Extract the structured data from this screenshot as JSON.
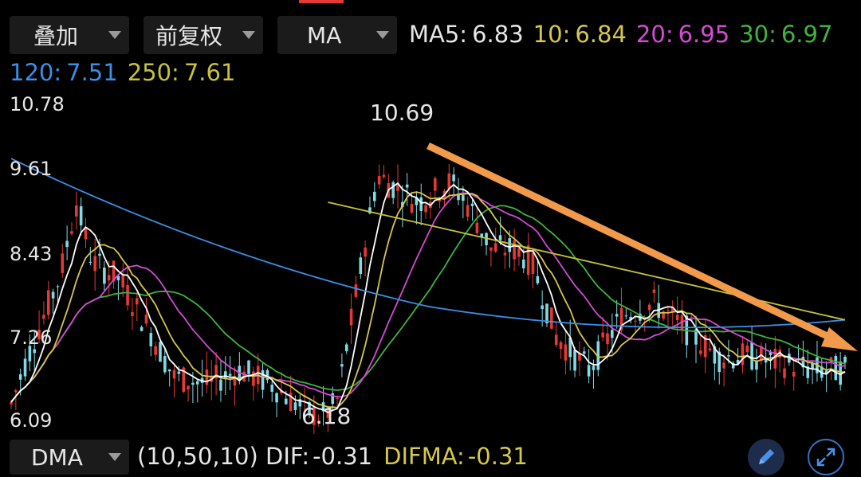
{
  "toolbar": {
    "overlay": "叠加",
    "adjust": "前复权",
    "indicator": "MA"
  },
  "ma": {
    "ma5_label": "MA5:",
    "ma5": "6.83",
    "ma10_label": "10:",
    "ma10": "6.84",
    "ma20_label": "20:",
    "ma20": "6.95",
    "ma30_label": "30:",
    "ma30": "6.97",
    "ma120_label": "120:",
    "ma120": "7.51",
    "ma250_label": "250:",
    "ma250": "7.61"
  },
  "colors": {
    "up": "#e53935",
    "down": "#7fdbe6",
    "ma5": "#ffffff",
    "ma10": "#d6c84a",
    "ma20": "#d54bd5",
    "ma30": "#3fb43f",
    "ma120": "#3a8fe8",
    "ma250": "#c8c23a",
    "trend_arrow": "#f29a4c",
    "axis_text": "#e6e6e6"
  },
  "price_axis": [
    "10.78",
    "9.61",
    "8.43",
    "7.26",
    "6.09"
  ],
  "annotations": {
    "high": "10.69",
    "low": "6.18"
  },
  "chart_data": {
    "type": "candlestick",
    "ylim": [
      6.09,
      10.78
    ],
    "y_ticks": [
      10.78,
      9.61,
      8.43,
      7.26,
      6.09
    ],
    "max_price": 10.69,
    "min_price": 6.18,
    "candles": 180,
    "moving_averages": [
      "MA5",
      "MA10",
      "MA20",
      "MA30",
      "MA120",
      "MA250"
    ],
    "trend_line": "downward"
  },
  "bottom": {
    "indicator": "DMA",
    "params": "(10,50,10)",
    "dif_label": "DIF:",
    "dif": "-0.31",
    "difma_label": "DIFMA:",
    "difma": "-0.31"
  },
  "icons": {
    "edit": "pencil-icon",
    "expand": "expand-icon"
  }
}
